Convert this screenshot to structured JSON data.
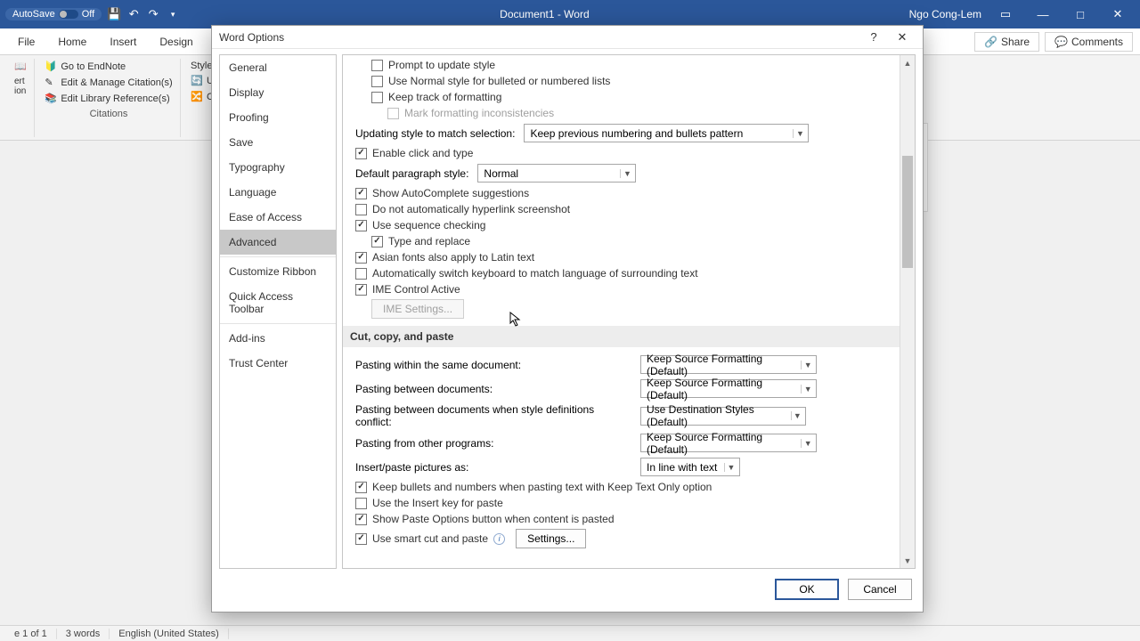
{
  "titlebar": {
    "autosave_label": "AutoSave",
    "autosave_state": "Off",
    "doc_title": "Document1 - Word",
    "username": "Ngo Cong-Lem"
  },
  "ribbon": {
    "tabs": [
      "File",
      "Home",
      "Insert",
      "Design"
    ],
    "share": "Share",
    "comments": "Comments",
    "style_label": "Style:",
    "go_to_endnote": "Go to EndNote",
    "edit_manage": "Edit & Manage Citation(s)",
    "edit_library": "Edit Library Reference(s)",
    "group_citations": "Citations",
    "update": "Up",
    "convert": "Co"
  },
  "statusbar": {
    "page": "e 1 of 1",
    "words": "3 words",
    "language": "English (United States)"
  },
  "dialog": {
    "title": "Word Options",
    "nav": {
      "general": "General",
      "display": "Display",
      "proofing": "Proofing",
      "save": "Save",
      "typography": "Typography",
      "language": "Language",
      "ease": "Ease of Access",
      "advanced": "Advanced",
      "customize_ribbon": "Customize Ribbon",
      "qat": "Quick Access Toolbar",
      "addins": "Add-ins",
      "trust": "Trust Center"
    },
    "options": {
      "prompt_update_style": "Prompt to update style",
      "use_normal_bulleted": "Use Normal style for bulleted or numbered lists",
      "keep_track_formatting": "Keep track of formatting",
      "mark_inconsistencies": "Mark formatting inconsistencies",
      "updating_style_label": "Updating style to match selection:",
      "updating_style_value": "Keep previous numbering and bullets pattern",
      "enable_click_type": "Enable click and type",
      "default_para_style_label": "Default paragraph style:",
      "default_para_style_value": "Normal",
      "show_autocomplete": "Show AutoComplete suggestions",
      "no_auto_hyperlink": "Do not automatically hyperlink screenshot",
      "use_sequence_checking": "Use sequence checking",
      "type_and_replace": "Type and replace",
      "asian_fonts_latin": "Asian fonts also apply to Latin text",
      "auto_switch_keyboard": "Automatically switch keyboard to match language of surrounding text",
      "ime_control_active": "IME Control Active",
      "ime_settings_btn": "IME Settings...",
      "section_cut_copy_paste": "Cut, copy, and paste",
      "pasting_same_doc_label": "Pasting within the same document:",
      "pasting_same_doc_value": "Keep Source Formatting (Default)",
      "pasting_between_label": "Pasting between documents:",
      "pasting_between_value": "Keep Source Formatting (Default)",
      "pasting_between_conflict_label": "Pasting between documents when style definitions conflict:",
      "pasting_between_conflict_value": "Use Destination Styles (Default)",
      "pasting_other_programs_label": "Pasting from other programs:",
      "pasting_other_programs_value": "Keep Source Formatting (Default)",
      "insert_paste_pictures_label": "Insert/paste pictures as:",
      "insert_paste_pictures_value": "In line with text",
      "keep_bullets_numbers": "Keep bullets and numbers when pasting text with Keep Text Only option",
      "use_insert_key": "Use the Insert key for paste",
      "show_paste_options": "Show Paste Options button when content is pasted",
      "use_smart_cut_paste": "Use smart cut and paste",
      "settings_btn": "Settings..."
    },
    "footer": {
      "ok": "OK",
      "cancel": "Cancel"
    }
  }
}
